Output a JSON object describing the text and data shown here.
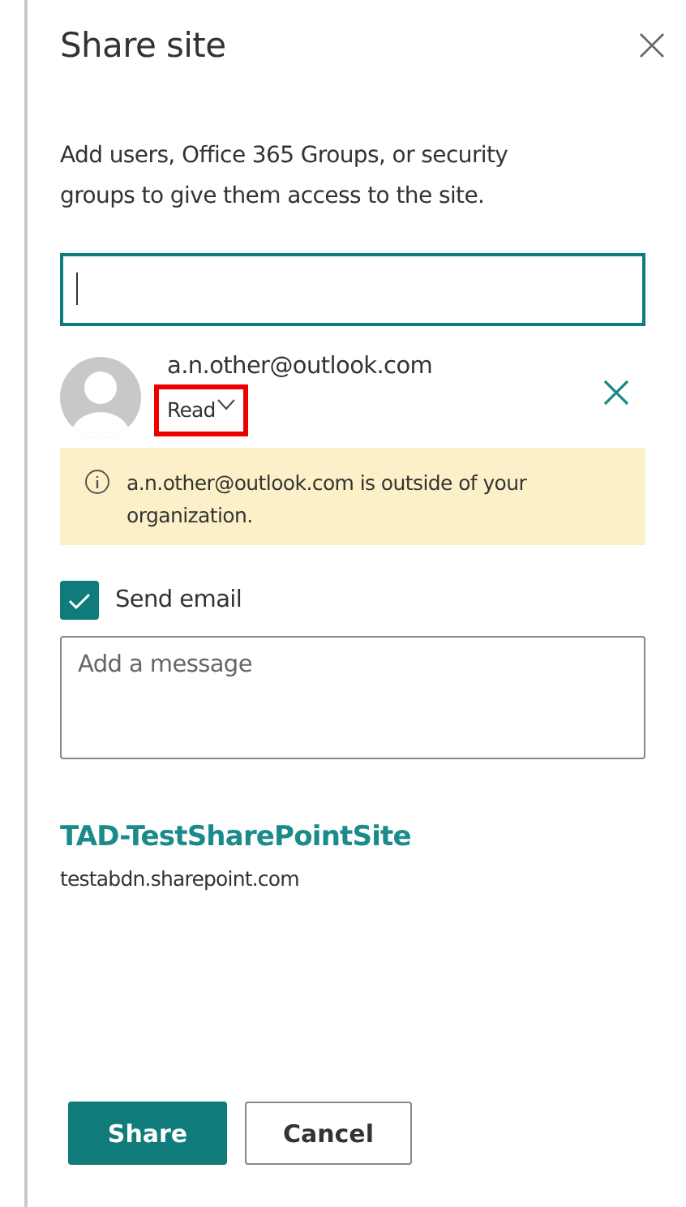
{
  "panel": {
    "title": "Share site",
    "description": "Add users, Office 365 Groups, or security groups to give them access to the site."
  },
  "recipients": [
    {
      "email": "a.n.other@outlook.com",
      "permission": "Read",
      "highlighted": true
    }
  ],
  "warning": {
    "text": "a.n.other@outlook.com is outside of your organization."
  },
  "send_email": {
    "label": "Send email",
    "checked": true
  },
  "message": {
    "placeholder": "Add a message"
  },
  "site": {
    "name": "TAD-TestSharePointSite",
    "url": "testabdn.sharepoint.com"
  },
  "buttons": [
    {
      "kind": "primary",
      "label": "Share"
    },
    {
      "kind": "secondary",
      "label": "Cancel"
    }
  ]
}
